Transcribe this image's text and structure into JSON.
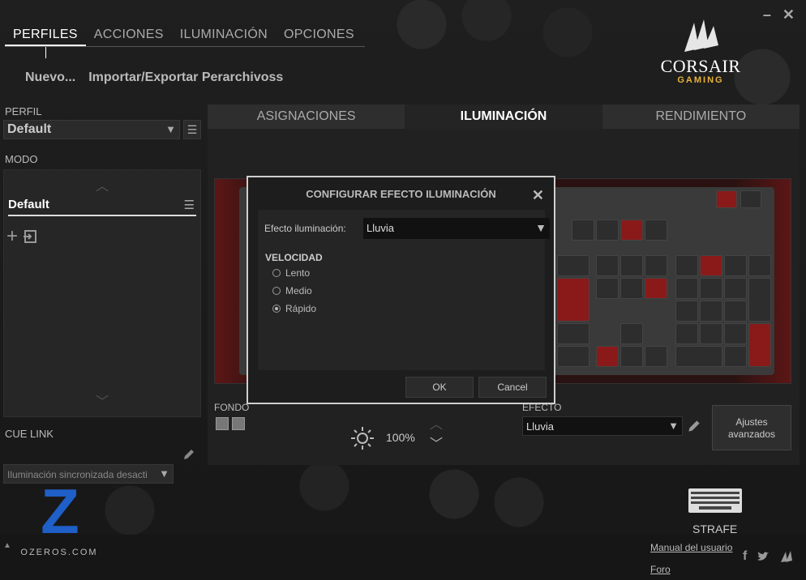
{
  "window": {
    "minimize": "–",
    "close": "✕"
  },
  "top_nav": {
    "tabs": [
      "PERFILES",
      "ACCIONES",
      "ILUMINACIÓN",
      "OPCIONES"
    ]
  },
  "sub_nav": {
    "new": "Nuevo...",
    "import_export": "Importar/Exportar Perarchivoss"
  },
  "logo": {
    "brand": "CORSAIR",
    "sub": "GAMING"
  },
  "left": {
    "profile_label": "PERFIL",
    "profile_value": "Default",
    "mode_label": "MODO",
    "mode_item": "Default",
    "add_icon": "+",
    "cue_link_label": "CUE LINK",
    "cue_link_value": "Iluminación sincronizada desacti",
    "select_arrow": "▼",
    "menu_icon": "☰"
  },
  "panel": {
    "tabs": [
      "ASIGNACIONES",
      "ILUMINACIÓN",
      "RENDIMIENTO"
    ],
    "fondo_label": "FONDO",
    "brightness": "100%",
    "efecto_label": "EFECTO",
    "efecto_value": "Lluvia",
    "advanced_button": "Ajustes avanzados"
  },
  "dialog": {
    "title": "CONFIGURAR EFECTO ILUMINACIÓN",
    "close": "✕",
    "effect_label": "Efecto iluminación:",
    "effect_value": "Lluvia",
    "speed_label": "VELOCIDAD",
    "speed_options": [
      "Lento",
      "Medio",
      "Rápido"
    ],
    "ok": "OK",
    "cancel": "Cancel"
  },
  "footer": {
    "device": "STRAFE",
    "manual_link": "Manual del usuario",
    "forum_link": "Foro",
    "watermark": "OZEROS.COM",
    "watermark_letter": "Z"
  },
  "colors": {
    "accent_red": "#8a1a1a",
    "gold": "#e8b23a"
  }
}
